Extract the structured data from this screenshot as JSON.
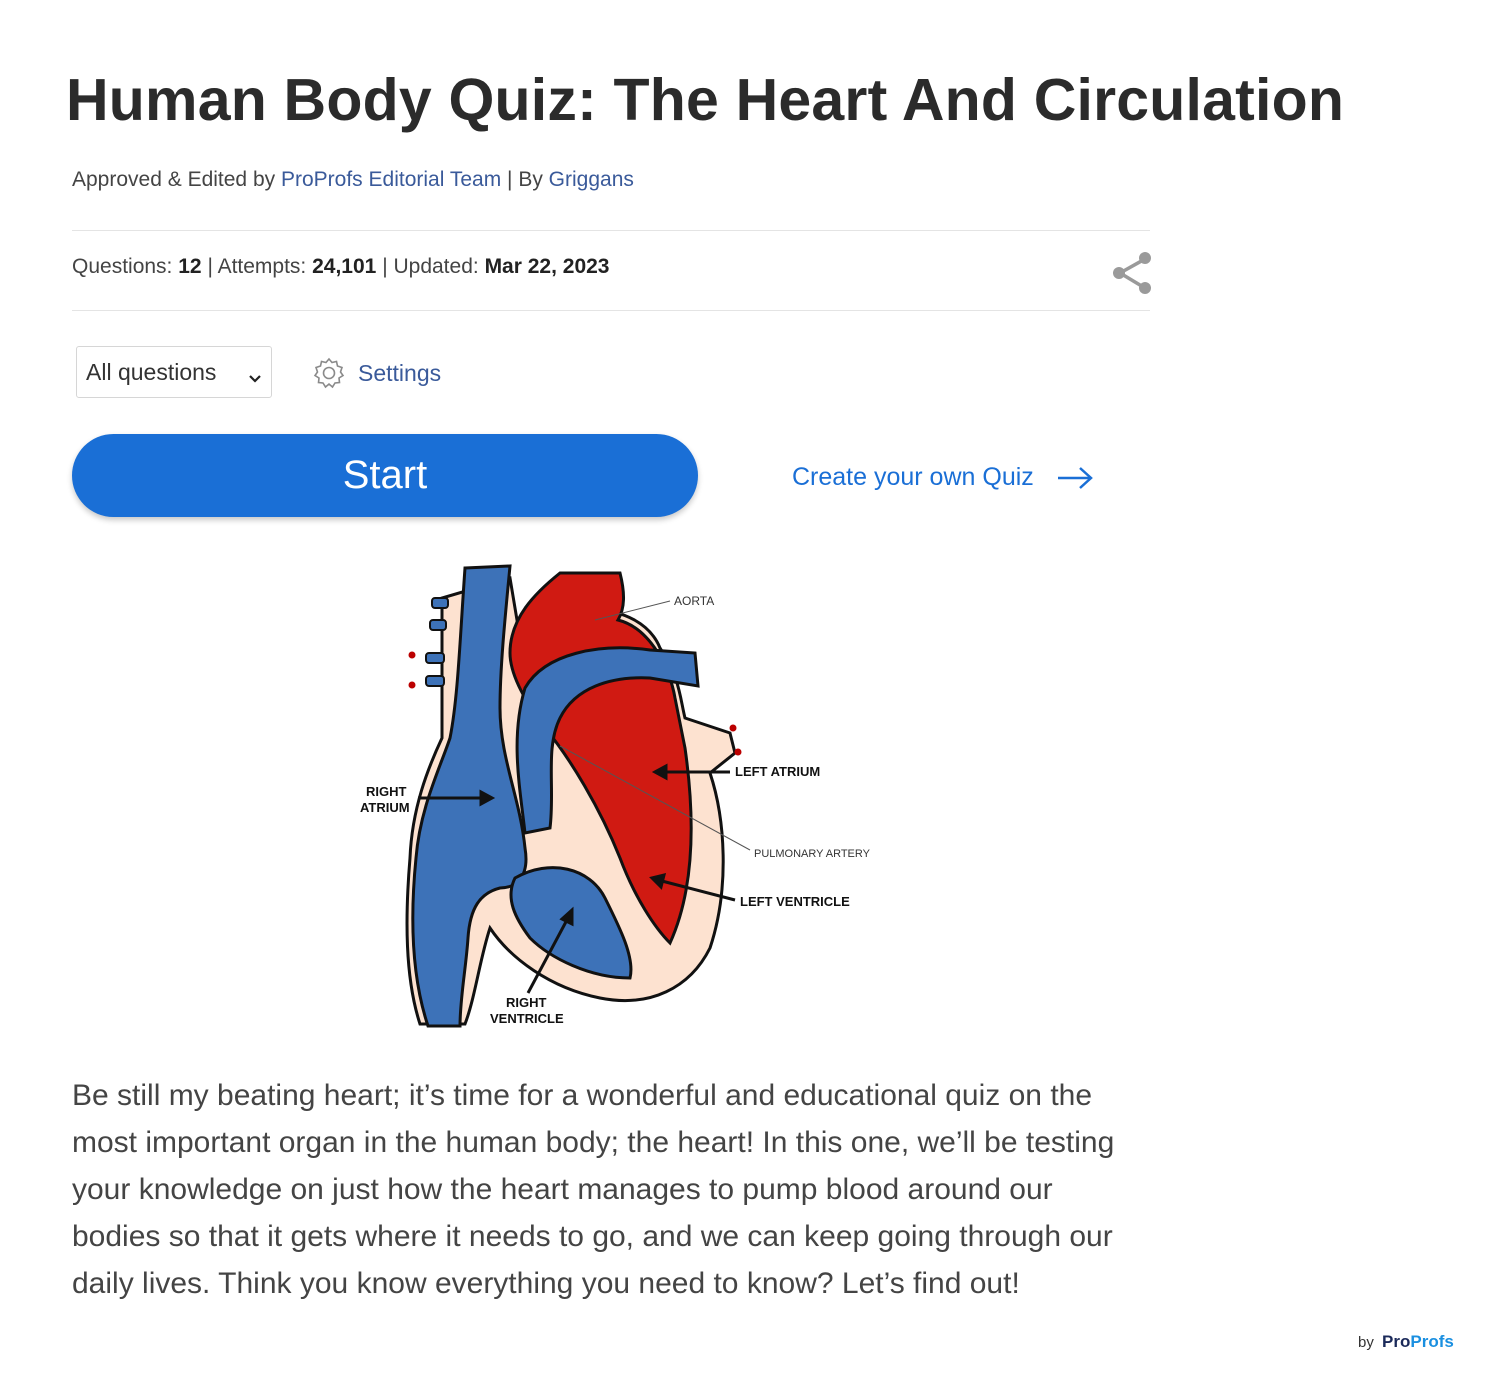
{
  "quiz": {
    "title": "Human Body Quiz: The Heart And Circulation",
    "byline": {
      "prefix": "Approved & Edited by",
      "editor": "ProProfs Editorial Team",
      "separator": "| By",
      "author": "Griggans"
    },
    "stats": {
      "questions_label": "Questions:",
      "questions_value": "12",
      "attempts_label": "| Attempts:",
      "attempts_value": "24,101",
      "updated_label": "| Updated:",
      "updated_value": "Mar 22, 2023"
    },
    "filter_selected": "All questions",
    "settings_label": "Settings",
    "start_label": "Start",
    "create_label": "Create your own Quiz",
    "description": "Be still my beating heart; it’s time for a wonderful and educational quiz on the most important organ in the human body; the heart! In this one, we’ll be testing your knowledge on just how the heart manages to pump blood around our bodies so that it gets where it needs to go, and we can keep going through our daily lives. Think you know everything you need to know? Let’s find out!"
  },
  "diagram_labels": {
    "aorta": "AORTA",
    "left_atrium": "LEFT ATRIUM",
    "right_atrium_1": "RIGHT",
    "right_atrium_2": "ATRIUM",
    "pulmonary_artery": "PULMONARY ARTERY",
    "left_ventricle": "LEFT VENTRICLE",
    "right_ventricle_1": "RIGHT",
    "right_ventricle_2": "VENTRICLE"
  },
  "footer": {
    "by": "by",
    "brand_part1": "Pro",
    "brand_part2": "Profs"
  },
  "colors": {
    "accent": "#1a6fd6",
    "link": "#3a5a9a",
    "heart_red": "#d01a12",
    "heart_blue": "#3d72b8",
    "heart_tissue": "#fde2d0"
  },
  "icons": {
    "share": "share-icon",
    "settings": "gear-icon",
    "dropdown": "chevron-down-icon",
    "arrow": "arrow-right-icon"
  }
}
